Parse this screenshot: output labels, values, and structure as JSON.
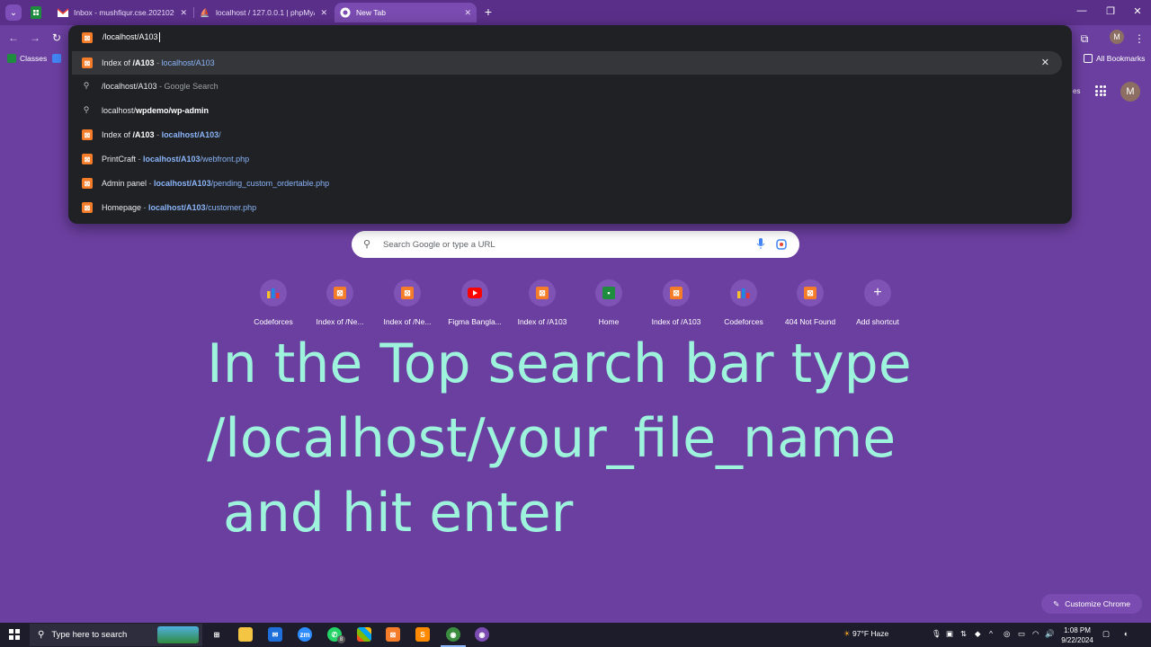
{
  "tabs": [
    {
      "title": "Inbox - mushfiqur.cse.2021020",
      "icon": "gmail-icon"
    },
    {
      "title": "localhost / 127.0.0.1 | phpMyAd",
      "icon": "phpmyadmin-icon"
    },
    {
      "title": "New Tab",
      "icon": "chrome-icon",
      "active": true
    }
  ],
  "toolbar": {
    "profile_initial": "M"
  },
  "bookmarks": {
    "classes": "Classes",
    "all": "All Bookmarks"
  },
  "omnibox": {
    "input": "/localhost/A103",
    "suggestions": [
      {
        "title": "Index of ",
        "title_bold": "/A103",
        "sep": " - ",
        "url_bold": "localhost/A103",
        "url_rest": "",
        "type": "history"
      },
      {
        "query": "/localhost/A103",
        "suffix": " - Google Search",
        "type": "search"
      },
      {
        "query_plain": "localhost/",
        "query_bold": "wpdemo/wp-admin",
        "type": "search"
      },
      {
        "title": "Index of ",
        "title_bold": "/A103",
        "sep": " - ",
        "url_bold": "localhost/A103",
        "url_rest": "/",
        "type": "history"
      },
      {
        "title": "PrintCraft",
        "sep": " - ",
        "url_bold": "localhost/A103",
        "url_rest": "/webfront.php",
        "type": "history"
      },
      {
        "title": "Admin panel",
        "sep": " - ",
        "url_bold": "localhost/A103",
        "url_rest": "/pending_custom_ordertable.php",
        "type": "history"
      },
      {
        "title": "Homepage",
        "sep": " - ",
        "url_bold": "localhost/A103",
        "url_rest": "/customer.php",
        "type": "history"
      }
    ]
  },
  "ntp": {
    "partial_label": "es",
    "avatar": "M",
    "search_placeholder": "Search Google or type a URL",
    "shortcuts": [
      {
        "label": "Codeforces",
        "icon": "codeforces-icon"
      },
      {
        "label": "Index of /Ne...",
        "icon": "xampp-icon"
      },
      {
        "label": "Index of /Ne...",
        "icon": "xampp-icon"
      },
      {
        "label": "Figma Bangla...",
        "icon": "youtube-icon"
      },
      {
        "label": "Index of /A103",
        "icon": "xampp-icon"
      },
      {
        "label": "Home",
        "icon": "classroom-icon"
      },
      {
        "label": "Index of /A103",
        "icon": "xampp-icon"
      },
      {
        "label": "Codeforces",
        "icon": "codeforces-icon"
      },
      {
        "label": "404 Not Found",
        "icon": "xampp-icon"
      },
      {
        "label": "Add shortcut",
        "icon": "plus-icon"
      }
    ],
    "customize": "Customize Chrome"
  },
  "overlay": {
    "line1": "In the Top search bar type",
    "line2": "/localhost/your_file_name",
    "line3": "and hit enter"
  },
  "taskbar": {
    "search_text": "Type here to search",
    "weather": "97°F  Haze",
    "time": "1:08 PM",
    "date": "9/22/2024",
    "whatsapp_badge": "8"
  },
  "colors": {
    "page_bg": "#6b3fa0",
    "omnibox_bg": "#202124",
    "overlay_text": "#9ef3dc",
    "link_blue": "#8ab4f8"
  }
}
